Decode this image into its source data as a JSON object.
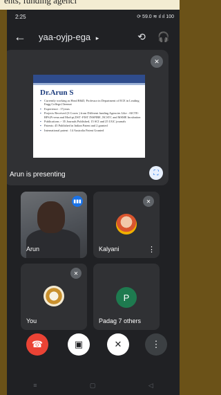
{
  "background_doc_text": "ents, funding agenci",
  "status_bar": {
    "time": "2:25",
    "right": "⟳ 59.0 ≋ ıl ıl 100"
  },
  "meeting": {
    "code": "yaa-oyjp-ega"
  },
  "presentation": {
    "caption": "Arun is presenting",
    "slide_title": "Dr.Arun S",
    "slide_bullets": [
      "Currently working as Head R&D, Professor in Department of ECE in Leading Engg College,Chennai",
      "Experience : 17years",
      "Projects Received (3 Crores ) from Different funding Agencies Like : AICTE- RPS,Pi-rena and Mod-pi,DST -FIST INSPIRE ,NCSTC and MSME Incubation",
      "Publications :- 35 Journals Published, 15 SCI and 25 UGC journals",
      "Patents: 45 Published in Indian Patent and 2 granted",
      "International patent : 14 Australia Patent Granted"
    ]
  },
  "participants": [
    {
      "name": "Arun"
    },
    {
      "name": "Kalyani"
    },
    {
      "name": "You"
    },
    {
      "name": "Padag 7 others",
      "initial": "P"
    }
  ],
  "icons": {
    "back": "←",
    "chevron": "▸",
    "switch_camera": "⟲",
    "audio": "🎧",
    "mic_off": "✕",
    "expand": "⛶",
    "more": "⋮",
    "speaking": "▮▮▮",
    "end_call": "☎",
    "camera_off": "▣",
    "nav_home": "▢",
    "nav_back": "◁",
    "nav_recent": "≡"
  }
}
